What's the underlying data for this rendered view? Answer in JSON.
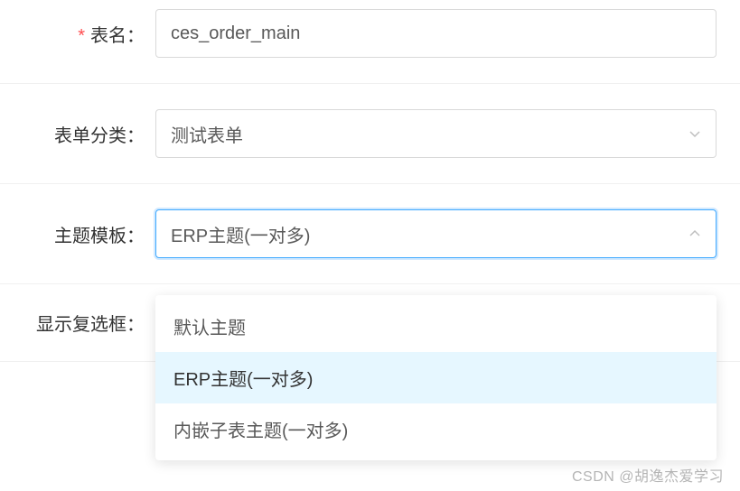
{
  "form": {
    "tableName": {
      "label": "表名",
      "value": "ces_order_main",
      "required": true
    },
    "formCategory": {
      "label": "表单分类",
      "value": "测试表单"
    },
    "themeTemplate": {
      "label": "主题模板",
      "value": "ERP主题(一对多)",
      "options": [
        "默认主题",
        "ERP主题(一对多)",
        "内嵌子表主题(一对多)"
      ],
      "selectedIndex": 1
    },
    "showCheckbox": {
      "label": "显示复选框"
    }
  },
  "watermark": "CSDN @胡逸杰爱学习",
  "colon": "："
}
